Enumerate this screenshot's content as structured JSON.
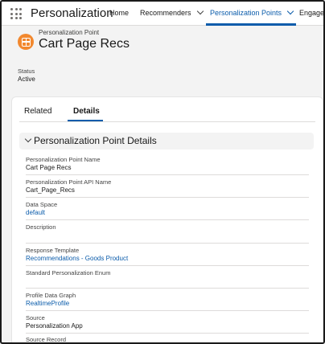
{
  "app": {
    "name": "Personalization"
  },
  "nav": {
    "items": [
      {
        "label": "Home",
        "has_menu": false
      },
      {
        "label": "Recommenders",
        "has_menu": true
      },
      {
        "label": "Personalization Points",
        "has_menu": true,
        "active": true
      },
      {
        "label": "Engagen",
        "has_menu": false
      }
    ]
  },
  "record": {
    "object_type": "Personalization Point",
    "title": "Cart Page Recs",
    "icon": "personalization-point-icon",
    "status_label": "Status",
    "status_value": "Active"
  },
  "tabs": [
    {
      "label": "Related",
      "active": false
    },
    {
      "label": "Details",
      "active": true
    }
  ],
  "section": {
    "title": "Personalization Point Details",
    "expanded": true
  },
  "fields": [
    {
      "label": "Personalization Point Name",
      "value": "Cart Page Recs",
      "link": false
    },
    {
      "label": "Personalization Point API Name",
      "value": "Cart_Page_Recs",
      "link": false
    },
    {
      "label": "Data Space",
      "value": "default",
      "link": true
    },
    {
      "label": "Description",
      "value": "",
      "link": false
    },
    {
      "label": "Response Template",
      "value": "Recommendations - Goods Product",
      "link": true
    },
    {
      "label": "Standard Personalization Enum",
      "value": "",
      "link": false
    },
    {
      "label": "Profile Data Graph",
      "value": "RealtimeProfile",
      "link": true
    },
    {
      "label": "Source",
      "value": "Personalization App",
      "link": false
    },
    {
      "label": "Source Record",
      "value": "",
      "link": false
    }
  ],
  "colors": {
    "brand": "#0b5cab",
    "icon_bg": "#f2882e",
    "page_bg": "#f3f3f3"
  }
}
